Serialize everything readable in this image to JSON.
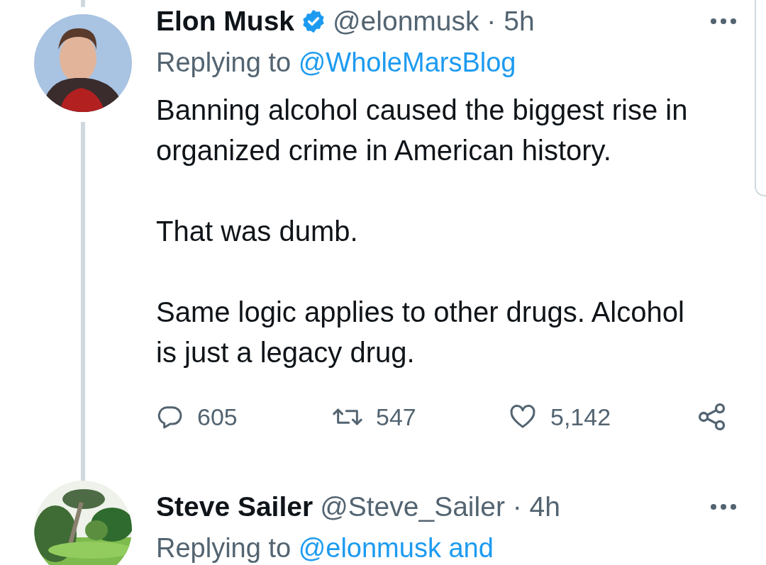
{
  "tweets": [
    {
      "author": "Elon Musk",
      "verified": true,
      "meta": "@elonmusk · 5h",
      "replying_label": "Replying to",
      "replying_to": "@WholeMarsBlog",
      "avatar": {
        "kind": "picture"
      },
      "thread_above": true,
      "thread_below": true,
      "paragraphs": [
        "Banning alcohol caused the biggest rise in organized crime in American history.",
        "That was dumb.",
        "Same logic applies to other drugs. Alcohol is just a legacy drug."
      ],
      "actions": [
        {
          "kind": "reply",
          "count": "605"
        },
        {
          "kind": "retweet",
          "count": "547"
        },
        {
          "kind": "like",
          "count": "5,142"
        },
        {
          "kind": "share"
        }
      ]
    },
    {
      "author": "Steve Sailer",
      "verified": false,
      "meta": "@Steve_Sailer · 4h",
      "replying_label": "Replying to",
      "replying_to": "@elonmusk and",
      "avatar": {
        "kind": "picture"
      },
      "thread_above": false,
      "thread_below": false
    }
  ]
}
